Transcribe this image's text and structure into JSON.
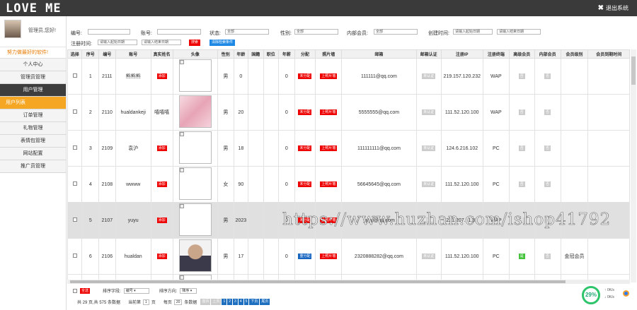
{
  "app": {
    "logo": "LOVE ME",
    "logout": "退出系统"
  },
  "sidebar": {
    "welcome": "管理员,您好!",
    "motto": "努力做最好的软件!",
    "items": [
      {
        "label": "个人中心",
        "state": "normal"
      },
      {
        "label": "管理员管理",
        "state": "normal"
      },
      {
        "label": "用户管理",
        "state": "active"
      },
      {
        "label": "用户列表",
        "state": "sub"
      },
      {
        "label": "订单管理",
        "state": "normal"
      },
      {
        "label": "礼物管理",
        "state": "normal"
      },
      {
        "label": "表情包管理",
        "state": "normal"
      },
      {
        "label": "网站配置",
        "state": "normal"
      },
      {
        "label": "推广员管理",
        "state": "normal"
      }
    ]
  },
  "filters": {
    "id_label": "编号:",
    "account_label": "账号:",
    "status_label": "状态:",
    "status_value": "全部",
    "gender_label": "性别:",
    "gender_value": "全部",
    "member_label": "内部会员:",
    "member_value": "全部",
    "created_label": "创建时间:",
    "created_start_ph": "请输入起始日期",
    "created_end_ph": "请输入结束日期",
    "reg_label": "注册时间:",
    "reg_start_ph": "请输入起始日期",
    "reg_end_ph": "请输入结束日期",
    "search_btn": "搜索",
    "clear_btn": "清除检索条件"
  },
  "table": {
    "headers": [
      "选择",
      "序号",
      "编号",
      "账号",
      "真实姓名",
      "头像",
      "性别",
      "年龄",
      "国籍",
      "职位",
      "年薪",
      "分配",
      "照片墙",
      "邮箱",
      "邮箱认证",
      "注册IP",
      "注册终端",
      "高级会员",
      "内部会员",
      "会员级别",
      "会员到期时间"
    ],
    "rows": [
      {
        "seq": "1",
        "id": "2111",
        "account": "熊熊熊",
        "realname": "添加",
        "photo": "broken",
        "gender": "男",
        "age": "0",
        "salary": "0",
        "assign": "未分配",
        "wall": "上照片墙",
        "email": "111111@qq.com",
        "verify": "未认证",
        "ip": "219.157.120.232",
        "term": "WAP",
        "vip": "否",
        "inner": "否",
        "level": "",
        "expire": ""
      },
      {
        "seq": "2",
        "id": "2110",
        "account": "hualdankeji",
        "realname": "嘻嘻嘻",
        "photo": "pink",
        "gender": "男",
        "age": "20",
        "salary": "0",
        "assign": "未分配",
        "wall": "上照片墙",
        "email": "5555555@qq.com",
        "verify": "未认证",
        "ip": "111.52.120.100",
        "term": "WAP",
        "vip": "否",
        "inner": "否",
        "level": "",
        "expire": ""
      },
      {
        "seq": "3",
        "id": "2109",
        "account": "袁沪",
        "realname": "添加",
        "photo": "broken",
        "gender": "男",
        "age": "18",
        "salary": "0",
        "assign": "未分配",
        "wall": "上照片墙",
        "email": "111111111@qq.com",
        "verify": "未认证",
        "ip": "124.6.216.102",
        "term": "PC",
        "vip": "否",
        "inner": "否",
        "level": "",
        "expire": ""
      },
      {
        "seq": "4",
        "id": "2108",
        "account": "wwww",
        "realname": "添加",
        "photo": "broken",
        "gender": "女",
        "age": "90",
        "salary": "0",
        "assign": "未分配",
        "wall": "上照片墙",
        "email": "56645645@qq.com",
        "verify": "未认证",
        "ip": "111.52.120.100",
        "term": "PC",
        "vip": "否",
        "inner": "否",
        "level": "",
        "expire": ""
      },
      {
        "seq": "5",
        "id": "2107",
        "account": "yuyu",
        "realname": "添加",
        "photo": "broken",
        "gender": "男",
        "age": "2023",
        "salary": "0",
        "assign": "未分配",
        "wall": "上照片墙",
        "email": "yuyu@qq.com",
        "verify": "未认证",
        "ip": "221.207.61.81",
        "term": "WAP",
        "vip": "否",
        "inner": "否",
        "level": "",
        "expire": ""
      },
      {
        "seq": "6",
        "id": "2106",
        "account": "hualdan",
        "realname": "添加",
        "photo": "boy",
        "gender": "男",
        "age": "17",
        "salary": "0",
        "assign": "重分配",
        "wall": "上照片墙",
        "email": "2320888282@qq.com",
        "verify": "未认证",
        "ip": "111.52.120.100",
        "term": "PC",
        "vip": "是",
        "inner": "否",
        "level": "金冠会员",
        "expire": ""
      },
      {
        "seq": "",
        "id": "",
        "account": "",
        "realname": "",
        "photo": "broken",
        "gender": "",
        "age": "",
        "salary": "",
        "assign": "",
        "wall": "",
        "email": "",
        "verify": "",
        "ip": "",
        "term": "",
        "vip": "",
        "inner": "",
        "level": "",
        "expire": ""
      }
    ]
  },
  "footer": {
    "select_all": "全选",
    "sort_field_label": "排序字段:",
    "sort_field_value": "编号",
    "sort_dir_label": "排序方向:",
    "sort_dir_value": "降序",
    "summary_a": "共 29 页,共 575 条数据",
    "cur_label": "当前第",
    "cur_page": "1",
    "cur_unit": "页",
    "per_label": "每页",
    "per_value": "20",
    "per_unit": "条数据",
    "pages": [
      "首页",
      "上页",
      "1",
      "2",
      "3",
      "4",
      "5",
      "下页",
      "尾页"
    ]
  },
  "watermark": "https://www.huzhan.com/ishop41792",
  "widget": {
    "percent": "29%",
    "line1": "0K/s",
    "line2": "0K/s"
  }
}
